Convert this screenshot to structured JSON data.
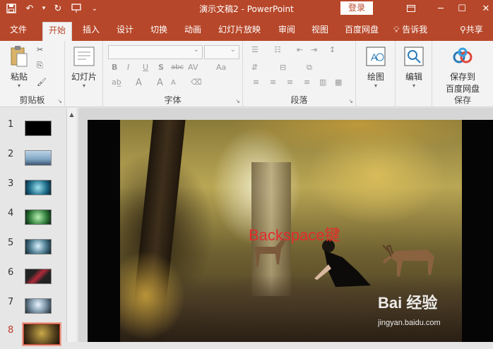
{
  "titlebar": {
    "document_title": "演示文稿2  -  PowerPoint",
    "login_label": "登录",
    "qat": {
      "save_icon": "save-icon",
      "undo_icon": "undo-icon",
      "redo_icon": "redo-icon",
      "customize_icon": "customize-icon"
    },
    "window_controls": [
      "ribbon-display-icon",
      "minimize-icon",
      "maximize-icon",
      "close-icon"
    ]
  },
  "tabs": [
    {
      "label": "文件"
    },
    {
      "label": "开始",
      "active": true
    },
    {
      "label": "插入"
    },
    {
      "label": "设计"
    },
    {
      "label": "切换"
    },
    {
      "label": "动画"
    },
    {
      "label": "幻灯片放映"
    },
    {
      "label": "审阅"
    },
    {
      "label": "视图"
    },
    {
      "label": "百度网盘"
    },
    {
      "label": "告诉我"
    },
    {
      "label": "共享"
    }
  ],
  "ribbon": {
    "clipboard": {
      "group_label": "剪贴板",
      "paste_label": "粘贴"
    },
    "slides": {
      "new_slide_label": "幻灯片"
    },
    "font": {
      "group_label": "字体",
      "buttons": [
        "B",
        "I",
        "U",
        "S",
        "abc",
        "AV",
        "A",
        "A",
        "A",
        "A"
      ]
    },
    "paragraph": {
      "group_label": "段落"
    },
    "drawing": {
      "drawing_label": "绘图"
    },
    "editing": {
      "editing_label": "编辑"
    },
    "save": {
      "group_label": "保存",
      "save_to_label_line1": "保存到",
      "save_to_label_line2": "百度网盘"
    }
  },
  "thumbnails": [
    {
      "number": "1"
    },
    {
      "number": "2"
    },
    {
      "number": "3"
    },
    {
      "number": "4"
    },
    {
      "number": "5"
    },
    {
      "number": "6"
    },
    {
      "number": "7"
    },
    {
      "number": "8",
      "selected": true
    }
  ],
  "slide": {
    "overlay_text": "Backspace键"
  },
  "watermark": {
    "main": "Bai 经验",
    "sub": "jingyan.baidu.com"
  },
  "colors": {
    "accent": "#b7472a",
    "ribbon_bg": "#f3f3f3",
    "overlay_text": "#e52b2b"
  }
}
